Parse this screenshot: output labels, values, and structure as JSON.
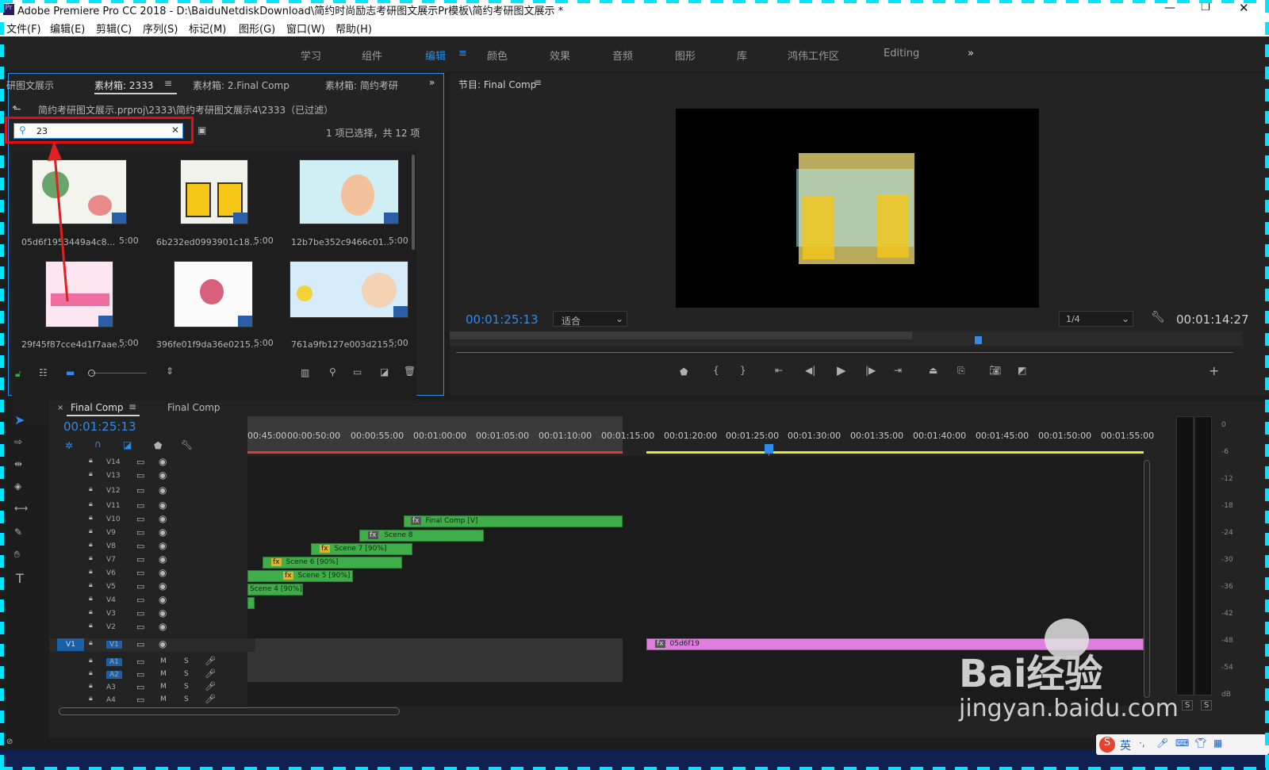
{
  "window": {
    "title": "Adobe Premiere Pro CC 2018 - D:\\BaiduNetdiskDownload\\简约时尚励志考研图文展示Pr模板\\简约考研图文展示 *"
  },
  "menu": [
    "文件(F)",
    "编辑(E)",
    "剪辑(C)",
    "序列(S)",
    "标记(M)",
    "图形(G)",
    "窗口(W)",
    "帮助(H)"
  ],
  "workspaces": [
    "学习",
    "组件",
    "编辑",
    "颜色",
    "效果",
    "音频",
    "图形",
    "库",
    "鸿伟工作区",
    "Editing"
  ],
  "project": {
    "tabs": [
      "研图文展示",
      "素材箱: 2333",
      "素材箱: 2.Final Comp",
      "素材箱: 简约考研"
    ],
    "path": "简约考研图文展示.prproj\\2333\\简约考研图文展示4\\2333（已过滤）",
    "search_value": "23",
    "selection_info": "1 项已选择，共 12 项",
    "items": [
      {
        "name": "05d6f1953449a4c8...",
        "dur": "5:00"
      },
      {
        "name": "6b232ed0993901c18...",
        "dur": "5:00"
      },
      {
        "name": "12b7be352c9466c01...",
        "dur": "5:00"
      },
      {
        "name": "29f45f87cce4d1f7aae...",
        "dur": "5:00"
      },
      {
        "name": "396fe01f9da36e0215...",
        "dur": "5:00"
      },
      {
        "name": "761a9fb127e003d215...",
        "dur": "5:00"
      }
    ]
  },
  "program": {
    "title": "节目: Final Comp",
    "timecode": "00:01:25:13",
    "fit": "适合",
    "resolution": "1/4",
    "duration": "00:01:14:27"
  },
  "timeline": {
    "tabs": [
      "Final Comp",
      "Final Comp"
    ],
    "timecode": "00:01:25:13",
    "ruler": [
      "00:45:00",
      "00:00:50:00",
      "00:00:55:00",
      "00:01:00:00",
      "00:01:05:00",
      "00:01:10:00",
      "00:01:15:00",
      "00:01:20:00",
      "00:01:25:00",
      "00:01:30:00",
      "00:01:35:00",
      "00:01:40:00",
      "00:01:45:00",
      "00:01:50:00",
      "00:01:55:00"
    ],
    "video_tracks": [
      "V14",
      "V13",
      "V12",
      "V11",
      "V10",
      "V9",
      "V8",
      "V7",
      "V6",
      "V5",
      "V4",
      "V3",
      "V2",
      "V1"
    ],
    "audio_tracks": [
      "A1",
      "A2",
      "A3",
      "A4"
    ],
    "clips": [
      "Final Comp [V]",
      "Scene 8",
      "Scene 7 [90%]",
      "Scene 6 [90%]",
      "Scene 5 [90%]",
      "Scene 4 [90%]",
      "05d6f19"
    ],
    "source_patch": "V1"
  },
  "meter": {
    "labels": [
      "0",
      "-6",
      "-12",
      "-18",
      "-24",
      "-30",
      "-36",
      "-42",
      "-48",
      "-54",
      "dB"
    ],
    "solo": [
      "S",
      "S"
    ]
  },
  "watermark": {
    "brand": "Bai经验",
    "url": "jingyan.baidu.com"
  },
  "ime": {
    "label": "英"
  }
}
